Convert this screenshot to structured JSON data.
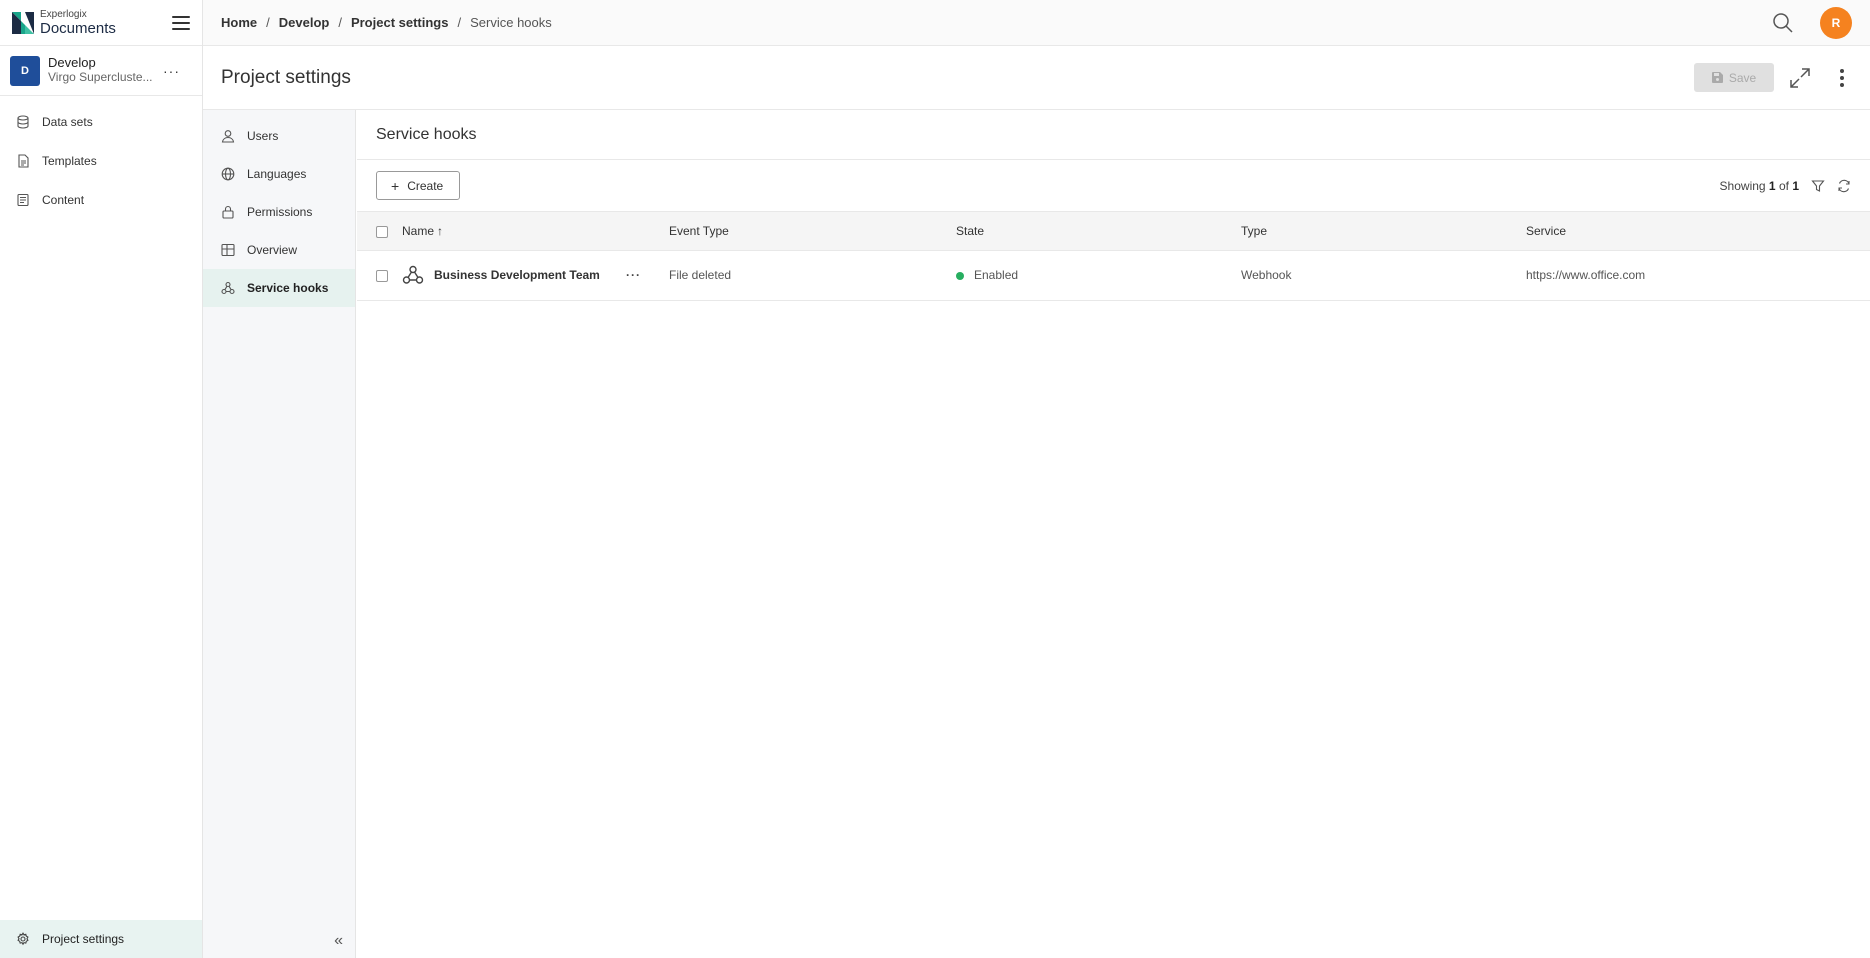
{
  "app": {
    "logo_small": "Experlogix",
    "logo_big": "Documents"
  },
  "project": {
    "initial": "D",
    "name": "Develop",
    "subtitle": "Virgo Supercluste..."
  },
  "sidebar": {
    "items": [
      {
        "label": "Data sets",
        "icon": "database-icon"
      },
      {
        "label": "Templates",
        "icon": "document-icon"
      },
      {
        "label": "Content",
        "icon": "content-icon"
      }
    ],
    "bottom_label": "Project settings"
  },
  "breadcrumb": {
    "items": [
      "Home",
      "Develop",
      "Project settings"
    ],
    "separator": "/",
    "current": "Service hooks"
  },
  "user": {
    "initial": "R",
    "color": "#f5821f"
  },
  "page": {
    "title": "Project settings",
    "save_label": "Save"
  },
  "subnav": {
    "items": [
      {
        "label": "Users",
        "icon": "user-icon"
      },
      {
        "label": "Languages",
        "icon": "globe-icon"
      },
      {
        "label": "Permissions",
        "icon": "lock-icon"
      },
      {
        "label": "Overview",
        "icon": "grid-icon"
      },
      {
        "label": "Service hooks",
        "icon": "webhook-icon",
        "active": true
      }
    ],
    "collapse_glyph": "«"
  },
  "content": {
    "title": "Service hooks",
    "create_label": "Create",
    "showing_prefix": "Showing",
    "showing_current": "1",
    "showing_of": "of",
    "showing_total": "1"
  },
  "table": {
    "columns": [
      "Name",
      "Event Type",
      "State",
      "Type",
      "Service"
    ],
    "sort_indicator": "↑",
    "rows": [
      {
        "name": "Business Development Team",
        "more": "···",
        "event_type": "File deleted",
        "state": "Enabled",
        "state_color": "#27ae60",
        "type": "Webhook",
        "service": "https://www.office.com"
      }
    ]
  },
  "colors": {
    "brand_blue": "#1f4e9a",
    "brand_teal": "#1aa58a",
    "active_bg": "#e6f2ef"
  }
}
